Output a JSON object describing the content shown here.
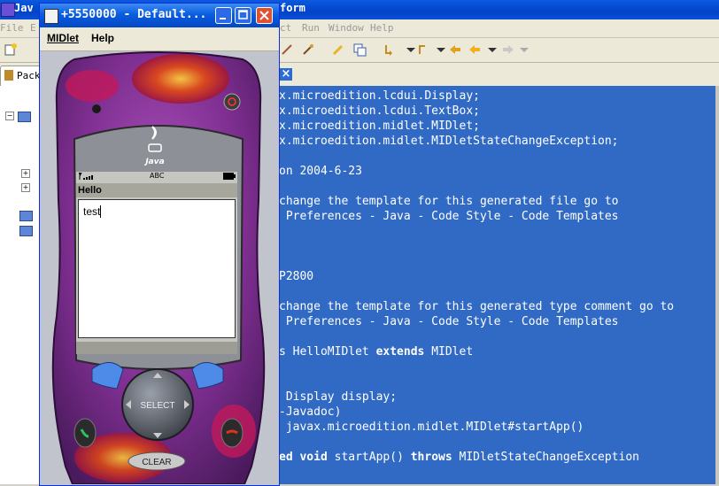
{
  "eclipse": {
    "title_left": "Jav",
    "title_right": "form",
    "menu": [
      "File",
      "E",
      "ct",
      "Run",
      "Window",
      "Help"
    ],
    "package_tab_label": "Pack",
    "code_lines": [
      {
        "text": "x.microedition.lcdui.Display;"
      },
      {
        "text": "x.microedition.lcdui.TextBox;"
      },
      {
        "text": "x.microedition.midlet.MIDlet;"
      },
      {
        "text": "x.microedition.midlet.MIDletStateChangeException;"
      },
      {
        "text": ""
      },
      {
        "text": "on 2004-6-23"
      },
      {
        "text": ""
      },
      {
        "text": "change the template for this generated file go to"
      },
      {
        "text": " Preferences - Java - Code Style - Code Templates"
      },
      {
        "text": ""
      },
      {
        "text": ""
      },
      {
        "text": ""
      },
      {
        "text": "P2800"
      },
      {
        "text": ""
      },
      {
        "text": "change the template for this generated type comment go to"
      },
      {
        "text": " Preferences - Java - Code Style - Code Templates"
      },
      {
        "text": ""
      },
      {
        "pre": "s HelloMIDlet ",
        "kw": "extends",
        "post": " MIDlet"
      },
      {
        "text": ""
      },
      {
        "text": ""
      },
      {
        "text": " Display display;"
      },
      {
        "text": "-Javadoc)"
      },
      {
        "text": " javax.microedition.midlet.MIDlet#startApp()"
      },
      {
        "text": ""
      },
      {
        "kw0": "ed void",
        "pre": " startApp() ",
        "kw": "throws",
        "post": " MIDletStateChangeException"
      }
    ]
  },
  "emulator": {
    "title": "+5550000 - Default...",
    "menu_midlet": "MIDlet",
    "menu_help": "Help",
    "phone": {
      "brand": "Java",
      "status_carrier": "ABC",
      "screen_title": "Hello",
      "textbox_value": "test",
      "select_label": "SELECT",
      "clear_label": "CLEAR"
    }
  },
  "colors": {
    "editor_bg": "#316ac5",
    "titlebar_blue": "#0a5de0",
    "phone_purple": "#8a3a9a"
  }
}
